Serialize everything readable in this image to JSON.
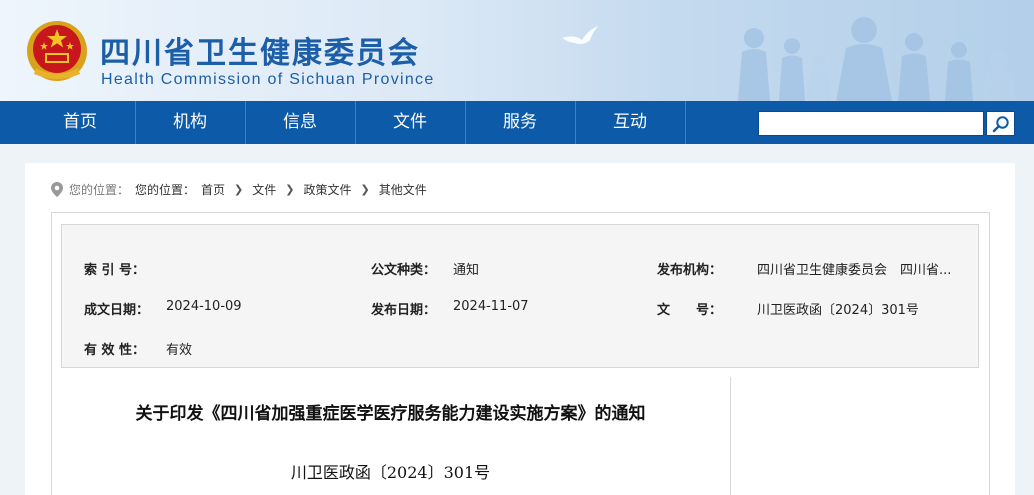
{
  "header": {
    "title": "四川省卫生健康委员会",
    "subtitle": "Health Commission of Sichuan Province"
  },
  "nav": {
    "items": [
      "首页",
      "机构",
      "信息",
      "文件",
      "服务",
      "互动"
    ],
    "search_value": ""
  },
  "breadcrumb": {
    "prefix": "您的位置：",
    "items": [
      "您的位置：",
      "首页",
      "文件",
      "政策文件",
      "其他文件"
    ]
  },
  "info": {
    "index_label": "索 引 号：",
    "index_value": "",
    "type_label": "公文种类：",
    "type_value": "通知",
    "publisher_label": "发布机构：",
    "publisher_value": "四川省卫生健康委员会　四川省...",
    "created_label": "成文日期：",
    "created_value": "2024-10-09",
    "published_label": "发布日期：",
    "published_value": "2024-11-07",
    "docno_label": "文　　号：",
    "docno_value": "川卫医政函〔2024〕301号",
    "validity_label": "有 效 性：",
    "validity_value": "有效"
  },
  "document": {
    "title": "关于印发《四川省加强重症医学医疗服务能力建设实施方案》的通知",
    "number": "川卫医政函〔2024〕301号"
  },
  "colors": {
    "nav_bg": "#0d5aa8",
    "title_blue": "#1c5ea8",
    "page_bg": "#eef3f8"
  }
}
